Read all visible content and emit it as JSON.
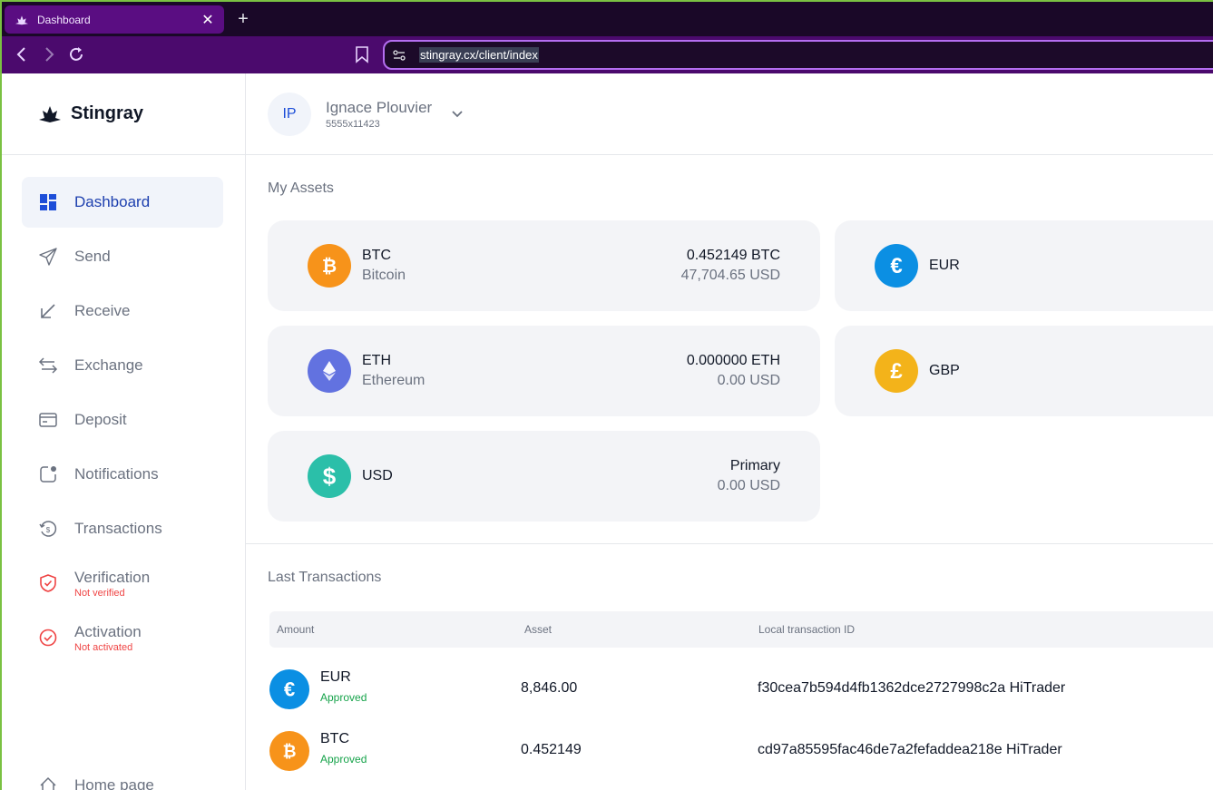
{
  "browser": {
    "tab_title": "Dashboard",
    "url": "stingray.cx/client/index"
  },
  "brand": {
    "name": "Stingray"
  },
  "sidebar": {
    "items": [
      {
        "label": "Dashboard",
        "icon": "dashboard-icon",
        "active": true
      },
      {
        "label": "Send",
        "icon": "send-icon"
      },
      {
        "label": "Receive",
        "icon": "receive-icon"
      },
      {
        "label": "Exchange",
        "icon": "exchange-icon"
      },
      {
        "label": "Deposit",
        "icon": "deposit-icon"
      },
      {
        "label": "Notifications",
        "icon": "notifications-icon"
      },
      {
        "label": "Transactions",
        "icon": "transactions-icon"
      },
      {
        "label": "Verification",
        "icon": "shield-icon",
        "status": "Not verified"
      },
      {
        "label": "Activation",
        "icon": "check-circle-icon",
        "status": "Not activated"
      }
    ],
    "home_label": "Home page"
  },
  "user": {
    "initials": "IP",
    "name": "Ignace Plouvier",
    "id": "5555x11423"
  },
  "assets": {
    "title": "My Assets",
    "items": [
      {
        "code": "BTC",
        "name": "Bitcoin",
        "amount": "0.452149 BTC",
        "usd": "47,704.65 USD",
        "color": "#f7931a"
      },
      {
        "code": "EUR",
        "color": "#0b8fe3"
      },
      {
        "code": "ETH",
        "name": "Ethereum",
        "amount": "0.000000 ETH",
        "usd": "0.00 USD",
        "color": "#6272e0"
      },
      {
        "code": "GBP",
        "color": "#f3b31a"
      },
      {
        "code": "USD",
        "amount": "Primary",
        "usd": "0.00 USD",
        "color": "#2bbfa9"
      }
    ]
  },
  "transactions": {
    "title": "Last Transactions",
    "columns": [
      "Amount",
      "Asset",
      "Local transaction ID"
    ],
    "rows": [
      {
        "code": "EUR",
        "status": "Approved",
        "amount": "8,846.00",
        "id": "f30cea7b594d4fb1362dce2727998c2a HiTrader",
        "color": "#0b8fe3"
      },
      {
        "code": "BTC",
        "status": "Approved",
        "amount": "0.452149",
        "id": "cd97a85595fac46de7a2fefaddea218e HiTrader",
        "color": "#f7931a"
      }
    ]
  }
}
